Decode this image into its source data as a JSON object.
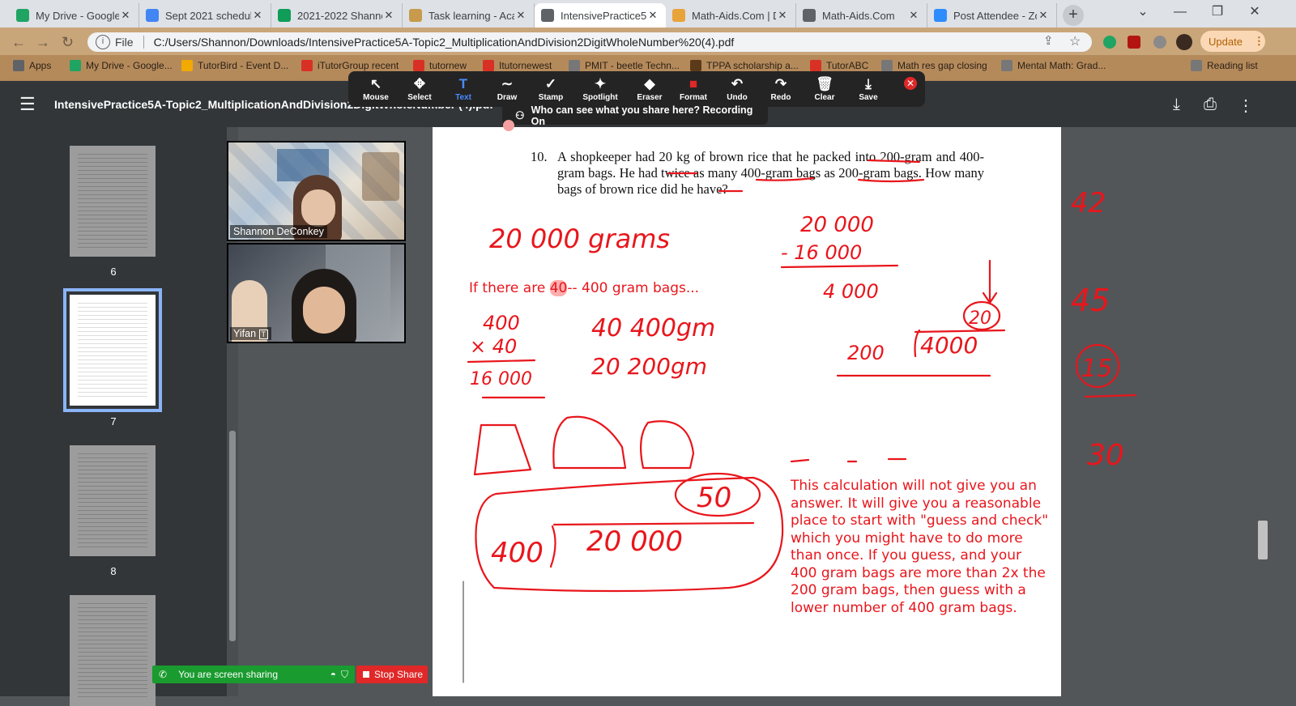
{
  "browser": {
    "tabs": [
      {
        "title": "My Drive - Google",
        "fav_color": "#1fa463",
        "active": false
      },
      {
        "title": "Sept 2021 schedule",
        "fav_color": "#4285f4",
        "active": false
      },
      {
        "title": "2021-2022 Shanno",
        "fav_color": "#0f9d58",
        "active": false
      },
      {
        "title": "Task learning - Aca",
        "fav_color": "#c79b4b",
        "active": false
      },
      {
        "title": "IntensivePractice5",
        "fav_color": "#5f6368",
        "active": true
      },
      {
        "title": "Math-Aids.Com | D",
        "fav_color": "#e8a33b",
        "active": false
      },
      {
        "title": "Math-Aids.Com",
        "fav_color": "#5f6368",
        "active": false
      },
      {
        "title": "Post Attendee - Zo",
        "fav_color": "#2d8cff",
        "active": false
      }
    ],
    "new_tab": "+",
    "window_buttons": [
      "⌄",
      "—",
      "❐",
      "✕"
    ],
    "address": {
      "scheme_label": "File",
      "url": "C:/Users/Shannon/Downloads/IntensivePractice5A-Topic2_MultiplicationAndDivision2DigitWholeNumber%20(4).pdf"
    },
    "update_label": "Update",
    "bookmarks": [
      {
        "label": "Apps",
        "color": "#5f6368"
      },
      {
        "label": "My Drive - Google...",
        "color": "#1fa463"
      },
      {
        "label": "TutorBird - Event D...",
        "color": "#f2a900"
      },
      {
        "label": "iTutorGroup recent",
        "color": "#d93025"
      },
      {
        "label": "tutornew",
        "color": "#d93025"
      },
      {
        "label": "Itutornewest",
        "color": "#d93025"
      },
      {
        "label": "PMIT - beetle Techn...",
        "color": "#777"
      },
      {
        "label": "TPPA scholarship a...",
        "color": "#5b3a1a"
      },
      {
        "label": "TutorABC",
        "color": "#d93025"
      },
      {
        "label": "Math res gap closing",
        "color": "#777"
      },
      {
        "label": "Mental Math: Grad...",
        "color": "#777"
      },
      {
        "label": "Reading list",
        "color": "#777"
      }
    ]
  },
  "pdf": {
    "title": "IntensivePractice5A-Topic2_MultiplicationAndDivision2DigitWholeNumber (4).pdf",
    "menu_icon": "☰",
    "page_numbers": [
      "6",
      "7",
      "8"
    ],
    "selected_page": "7",
    "problem_number": "10.",
    "problem_text": "A shopkeeper had 20 kg of brown rice that he packed into 200-gram and 400-gram bags. He had twice as many 400-gram bags as 200-gram bags. How many bags of brown rice did he have?",
    "typed_note_prefix": "If there are ",
    "typed_note_highlight": "40",
    "typed_note_suffix": "-- 400 gram bags...",
    "explanation": "This calculation will not give you an answer.  It will give you a reasonable place to start with \"guess and check\" which you might have to do more than once.  If you guess, and your 400 gram bags are more than 2x the 200 gram bags, then guess with a lower number of 400 gram bags.",
    "handwriting": {
      "grams": "20 000 grams",
      "sub_top": "20 000",
      "sub_mid": "- 16 000",
      "sub_result": "4 000",
      "mult_top": "400",
      "mult_mid": "× 40",
      "mult_result": "16 000",
      "bags_400": "40  400gm",
      "bags_200": "20  200gm",
      "div_quotient": "20",
      "div_divisor": "200",
      "div_dividend": "4000",
      "big_quotient": "50",
      "big_divisor": "400",
      "big_dividend": "20 000",
      "margin_numbers": [
        "42",
        "45",
        "15",
        "30"
      ]
    }
  },
  "zoom": {
    "tools": [
      {
        "label": "Mouse",
        "icon": "↖"
      },
      {
        "label": "Select",
        "icon": "✥"
      },
      {
        "label": "Text",
        "icon": "T"
      },
      {
        "label": "Draw",
        "icon": "∼"
      },
      {
        "label": "Stamp",
        "icon": "✓"
      },
      {
        "label": "Spotlight",
        "icon": "✦"
      },
      {
        "label": "Eraser",
        "icon": "◆"
      },
      {
        "label": "Format",
        "icon": "■"
      },
      {
        "label": "Undo",
        "icon": "↶"
      },
      {
        "label": "Redo",
        "icon": "↷"
      },
      {
        "label": "Clear",
        "icon": "🗑"
      },
      {
        "label": "Save",
        "icon": "⤓"
      }
    ],
    "share_info": "Who can see what you share here? Recording On",
    "participants": [
      "Shannon DeConkey",
      "Yifan"
    ],
    "sharing_status": "You are screen sharing",
    "stop_share": "Stop Share"
  },
  "colors": {
    "ink": "#e8161c",
    "zoom_green": "#1a9b2f",
    "zoom_red": "#e02828",
    "text_tool_active": "#4a8cff"
  }
}
